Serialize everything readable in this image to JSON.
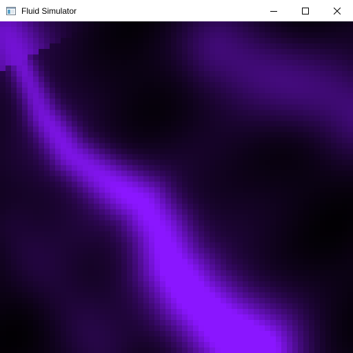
{
  "window": {
    "title": "Fluid Simulator",
    "app_icon": "app-window-icon",
    "controls": {
      "minimize_icon": "minimize-icon",
      "maximize_icon": "maximize-icon",
      "close_icon": "close-icon"
    }
  },
  "simulation": {
    "dye_color": "#8a16ff",
    "background_color": "#000000"
  }
}
